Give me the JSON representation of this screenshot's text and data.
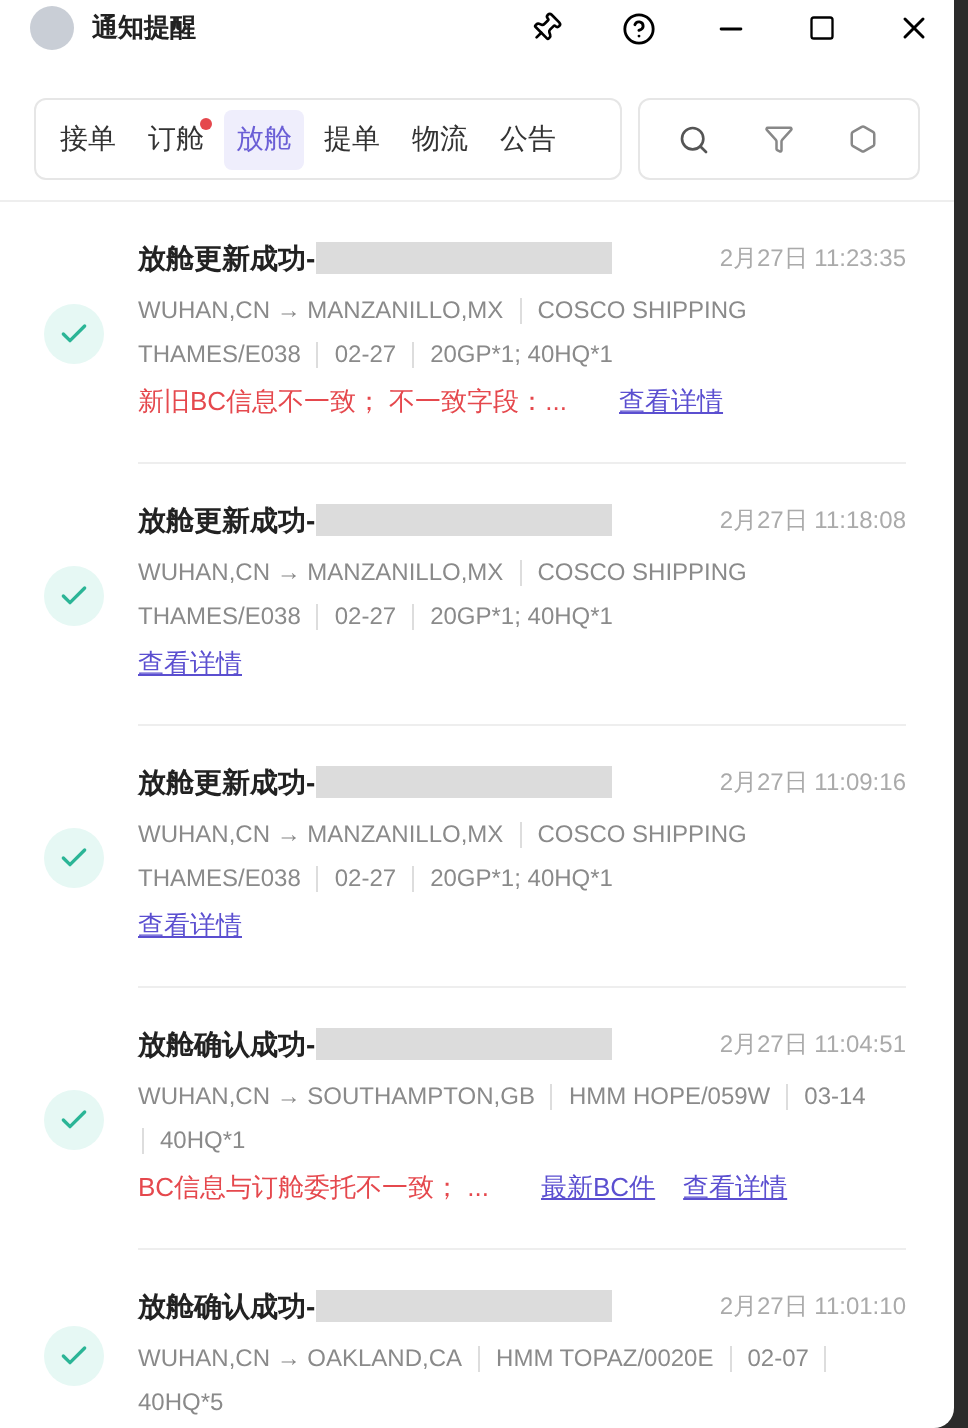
{
  "window": {
    "title": "通知提醒"
  },
  "tabs": [
    {
      "label": "接单",
      "selected": false,
      "unread": false
    },
    {
      "label": "订舱",
      "selected": false,
      "unread": true
    },
    {
      "label": "放舱",
      "selected": true,
      "unread": false
    },
    {
      "label": "提单",
      "selected": false,
      "unread": false
    },
    {
      "label": "物流",
      "selected": false,
      "unread": false
    },
    {
      "label": "公告",
      "selected": false,
      "unread": false
    }
  ],
  "notifications": [
    {
      "title": "放舱更新成功-",
      "time": "2月27日 11:23:35",
      "meta_lines": [
        [
          {
            "kind": "text",
            "text": "WUHAN,CN → MANZANILLO,MX"
          },
          {
            "kind": "divider"
          },
          {
            "kind": "text",
            "text": "COSCO SHIPPING"
          }
        ],
        [
          {
            "kind": "text",
            "text": "THAMES/E038"
          },
          {
            "kind": "divider"
          },
          {
            "kind": "text",
            "text": "02-27"
          },
          {
            "kind": "divider"
          },
          {
            "kind": "text",
            "text": "20GP*1; 40HQ*1"
          }
        ]
      ],
      "warning": "新旧BC信息不一致； 不一致字段：...",
      "links": [
        "查看详情"
      ]
    },
    {
      "title": "放舱更新成功-",
      "time": "2月27日 11:18:08",
      "meta_lines": [
        [
          {
            "kind": "text",
            "text": "WUHAN,CN → MANZANILLO,MX"
          },
          {
            "kind": "divider"
          },
          {
            "kind": "text",
            "text": "COSCO SHIPPING"
          }
        ],
        [
          {
            "kind": "text",
            "text": "THAMES/E038"
          },
          {
            "kind": "divider"
          },
          {
            "kind": "text",
            "text": "02-27"
          },
          {
            "kind": "divider"
          },
          {
            "kind": "text",
            "text": "20GP*1; 40HQ*1"
          }
        ]
      ],
      "links": [
        "查看详情"
      ]
    },
    {
      "title": "放舱更新成功-",
      "time": "2月27日 11:09:16",
      "meta_lines": [
        [
          {
            "kind": "text",
            "text": "WUHAN,CN → MANZANILLO,MX"
          },
          {
            "kind": "divider"
          },
          {
            "kind": "text",
            "text": "COSCO SHIPPING"
          }
        ],
        [
          {
            "kind": "text",
            "text": "THAMES/E038"
          },
          {
            "kind": "divider"
          },
          {
            "kind": "text",
            "text": "02-27"
          },
          {
            "kind": "divider"
          },
          {
            "kind": "text",
            "text": "20GP*1; 40HQ*1"
          }
        ]
      ],
      "links": [
        "查看详情"
      ]
    },
    {
      "title": "放舱确认成功-",
      "time": "2月27日 11:04:51",
      "meta_lines": [
        [
          {
            "kind": "text",
            "text": "WUHAN,CN → SOUTHAMPTON,GB"
          },
          {
            "kind": "divider"
          },
          {
            "kind": "text",
            "text": "HMM HOPE/059W"
          },
          {
            "kind": "divider"
          },
          {
            "kind": "text",
            "text": "03-14"
          }
        ],
        [
          {
            "kind": "divider"
          },
          {
            "kind": "text",
            "text": "40HQ*1"
          }
        ]
      ],
      "warning": "BC信息与订舱委托不一致； ...",
      "links": [
        "最新BC件",
        "查看详情"
      ]
    },
    {
      "title": "放舱确认成功-",
      "time": "2月27日 11:01:10",
      "meta_lines": [
        [
          {
            "kind": "text",
            "text": "WUHAN,CN → OAKLAND,CA"
          },
          {
            "kind": "divider"
          },
          {
            "kind": "text",
            "text": "HMM TOPAZ/0020E"
          },
          {
            "kind": "divider"
          },
          {
            "kind": "text",
            "text": "02-07"
          },
          {
            "kind": "divider"
          }
        ],
        [
          {
            "kind": "text",
            "text": "40HQ*5"
          }
        ]
      ]
    }
  ]
}
